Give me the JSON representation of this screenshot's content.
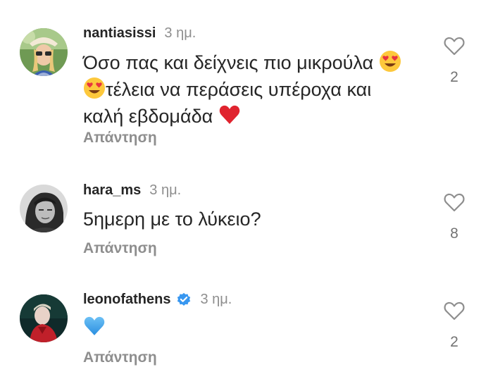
{
  "comments": [
    {
      "username": "nantiasissi",
      "time": "3 ημ.",
      "text_part1": "Όσο πας και δείχνεις πιο μικρούλα",
      "text_part2": "τέλεια να περάσεις υπέροχα και",
      "text_part3": "καλή εβδομάδα",
      "reply_label": "Απάντηση",
      "likes": "2",
      "verified": false
    },
    {
      "username": "hara_ms",
      "time": "3 ημ.",
      "text_part1": "5ημερη με το λύκειο?",
      "reply_label": "Απάντηση",
      "likes": "8",
      "verified": false
    },
    {
      "username": "leonofathens",
      "time": "3 ημ.",
      "reply_label": "Απάντηση",
      "likes": "2",
      "verified": true
    }
  ],
  "colors": {
    "text": "#262626",
    "secondary": "#8e8e8e",
    "verified_badge": "#3897f0",
    "red_heart": "#e0242f",
    "blue_heart": "#3aa1ee",
    "emoji_face": "#fdc83c",
    "emoji_heart_eyes": "#e8343f"
  },
  "icons": {
    "like": "heart-outline-icon",
    "verified": "verified-badge-icon",
    "emoji1": "heart-eyes-emoji",
    "emoji2": "red-heart-emoji",
    "emoji3": "blue-heart-emoji"
  }
}
